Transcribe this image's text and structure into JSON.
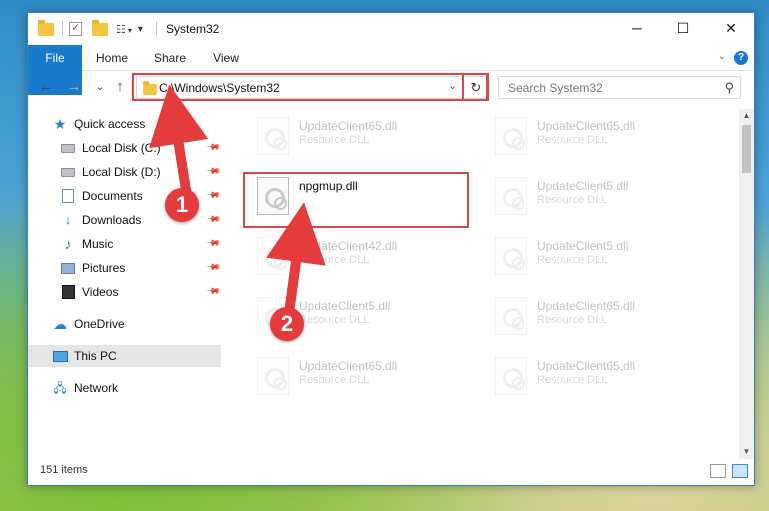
{
  "window": {
    "title": "System32",
    "minimize": "─",
    "maximize": "☐",
    "close": "✕"
  },
  "ribbon": {
    "tabs": [
      {
        "label": "File"
      },
      {
        "label": "Home"
      },
      {
        "label": "Share"
      },
      {
        "label": "View"
      }
    ],
    "help": "?",
    "collapse": "⌄"
  },
  "nav": {
    "back": "←",
    "forward": "→",
    "recent": "⌄",
    "up": "↑",
    "address": "C:\\Windows\\System32",
    "address_dropdown": "⌄",
    "refresh": "↻",
    "search_placeholder": "Search System32",
    "search_icon": "⚲"
  },
  "sidebar": {
    "items": [
      {
        "label": "Quick access",
        "icon": "star-icon"
      },
      {
        "label": "Local Disk (C:)",
        "icon": "drive-icon",
        "pinned": true
      },
      {
        "label": "Local Disk (D:)",
        "icon": "drive-icon",
        "pinned": true
      },
      {
        "label": "Documents",
        "icon": "documents-icon",
        "pinned": true
      },
      {
        "label": "Downloads",
        "icon": "downloads-icon",
        "pinned": true
      },
      {
        "label": "Music",
        "icon": "music-icon",
        "pinned": true
      },
      {
        "label": "Pictures",
        "icon": "pictures-icon",
        "pinned": true
      },
      {
        "label": "Videos",
        "icon": "videos-icon",
        "pinned": true
      },
      {
        "label": "OneDrive",
        "icon": "onedrive-icon"
      },
      {
        "label": "This PC",
        "icon": "this-pc-icon",
        "selected": true
      },
      {
        "label": "Network",
        "icon": "network-icon"
      }
    ]
  },
  "files": [
    {
      "name": "UpdateClient65.dll",
      "type": "Resource DLL"
    },
    {
      "name": "UpdateClient65.dll",
      "type": "Resource DLL"
    },
    {
      "name": "npgmup.dll",
      "type": "",
      "highlighted": true
    },
    {
      "name": "UpdateClient5.dll",
      "type": "Resource DLL"
    },
    {
      "name": "UpdateClient42.dll",
      "type": "Resource DLL"
    },
    {
      "name": "UpdateClient5.dll",
      "type": "Resource DLL"
    },
    {
      "name": "UpdateClient5.dll",
      "type": "Resource DLL"
    },
    {
      "name": "UpdateClient65.dll",
      "type": "Resource DLL"
    },
    {
      "name": "UpdateClient65.dll",
      "type": "Resource DLL"
    },
    {
      "name": "UpdateClient65.dll",
      "type": "Resource DLL"
    }
  ],
  "status": {
    "item_count": "151 items"
  },
  "callouts": [
    {
      "number": "1"
    },
    {
      "number": "2"
    }
  ],
  "colors": {
    "accent": "#1979ca",
    "highlight": "#d84646",
    "callout": "#e43c3c"
  }
}
